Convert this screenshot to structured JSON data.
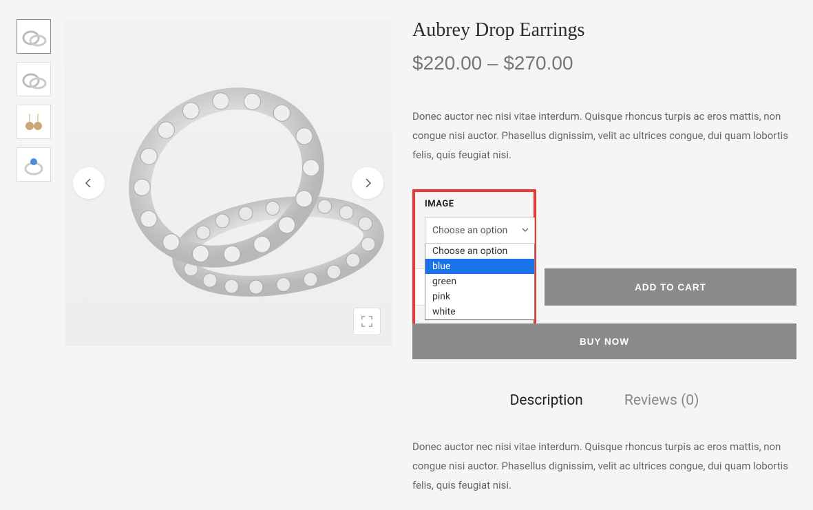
{
  "product": {
    "title": "Aubrey Drop Earrings",
    "price": "$220.00 – $270.00",
    "short_description": "Donec auctor nec nisi vitae interdum. Quisque rhoncus turpis ac eros mattis, non congue nisi auctor. Phasellus dignissim, velit ac ultrices congue, dui quam lobortis felis, quis feugiat nisi."
  },
  "variation": {
    "label": "IMAGE",
    "placeholder": "Choose an option",
    "options": [
      "Choose an option",
      "blue",
      "green",
      "pink",
      "white"
    ],
    "highlighted": "blue"
  },
  "actions": {
    "add_to_cart": "ADD TO CART",
    "buy_now": "BUY NOW"
  },
  "tabs": {
    "description_label": "Description",
    "reviews_label": "Reviews (0)",
    "description_content": "Donec auctor nec nisi vitae interdum. Quisque rhoncus turpis ac eros mattis, non congue nisi auctor. Phasellus dignissim, velit ac ultrices congue, dui quam lobortis felis, quis feugiat nisi."
  }
}
